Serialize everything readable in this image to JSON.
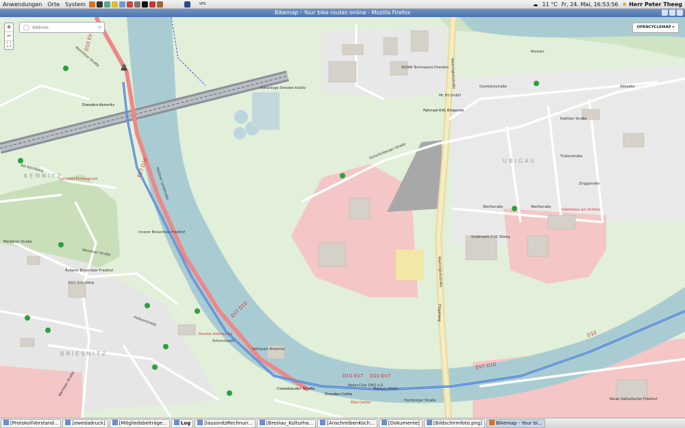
{
  "panel": {
    "menus": [
      "Anwendungen",
      "Orte",
      "System"
    ],
    "weather": "11 °C",
    "clock": "Fr, 24. Mai, 16:53:56",
    "user": "Herr Peter Theeg",
    "launcher_labels": [
      "VPS"
    ]
  },
  "window": {
    "title": "Bikemap - Your bike routes online - Mozilla Firefox"
  },
  "map": {
    "search_placeholder": "Address",
    "layer_label": "OPENCYCLEMAP",
    "zoom_in": "+",
    "zoom_out": "−",
    "districts": [
      "KEMNITZ",
      "BRIESNITZ",
      "UBIGAU",
      "Mickten"
    ],
    "streets": [
      "Scharfenberger Straße",
      "Overbeckstraße",
      "Werftstraße",
      "Washingtonstraße",
      "Merbitzer Straße",
      "Am Kirchberg",
      "Hamburger Straße",
      "Cossebauder Straße",
      "Kaditzer Straße",
      "Zinggstraße",
      "Thäterstraße",
      "Altkaditz",
      "Meißner Landstraße",
      "Flügelweg",
      "Warthaer Straße",
      "Kemnitzer Straße",
      "Holbeinstraße"
    ],
    "poi": [
      "Dresden-Kemnitz",
      "Dresden-Cotta",
      "SIGMA Technopark Dresden",
      "Kläranlage Dresden-Kaditz",
      "Fahrrad-XXL Emporon",
      "Großmarkt C+C Edeka",
      "Volkspark Briesnitz",
      "Äußerer Briesnitzer Friedhof",
      "Innerer Briesnitzer Friedhof",
      "Lehrpfad Eichengrund",
      "Neuer Katholischer Friedhof",
      "Gästehaus am Schloss",
      "Mc Fit GmbH",
      "Pension Altbriesnitz",
      "Schunckpark",
      "Roder-Club 1902 e.V.",
      "Merkurs Hütte",
      "Elbe-Center",
      "KGV Schulberg"
    ],
    "route_labels": [
      "D10 EV7",
      "EV7 D10",
      "EV7 D10",
      "D10 EV7",
      "D10 EV7",
      "EV7 D10",
      "D10"
    ]
  },
  "taskbar": {
    "tasks": [
      "[ProtokollVorstand...",
      "[ewedadruck]",
      "[Mitgliedsbeiträge...",
      "Log",
      "[laussnitzRechnun...",
      "[Breslau_Kulturha...",
      "[AnschreibenKoch...",
      "[Dokumente]",
      "[Bildschirmfoto.png]",
      "Bikemap - Your bi..."
    ]
  }
}
